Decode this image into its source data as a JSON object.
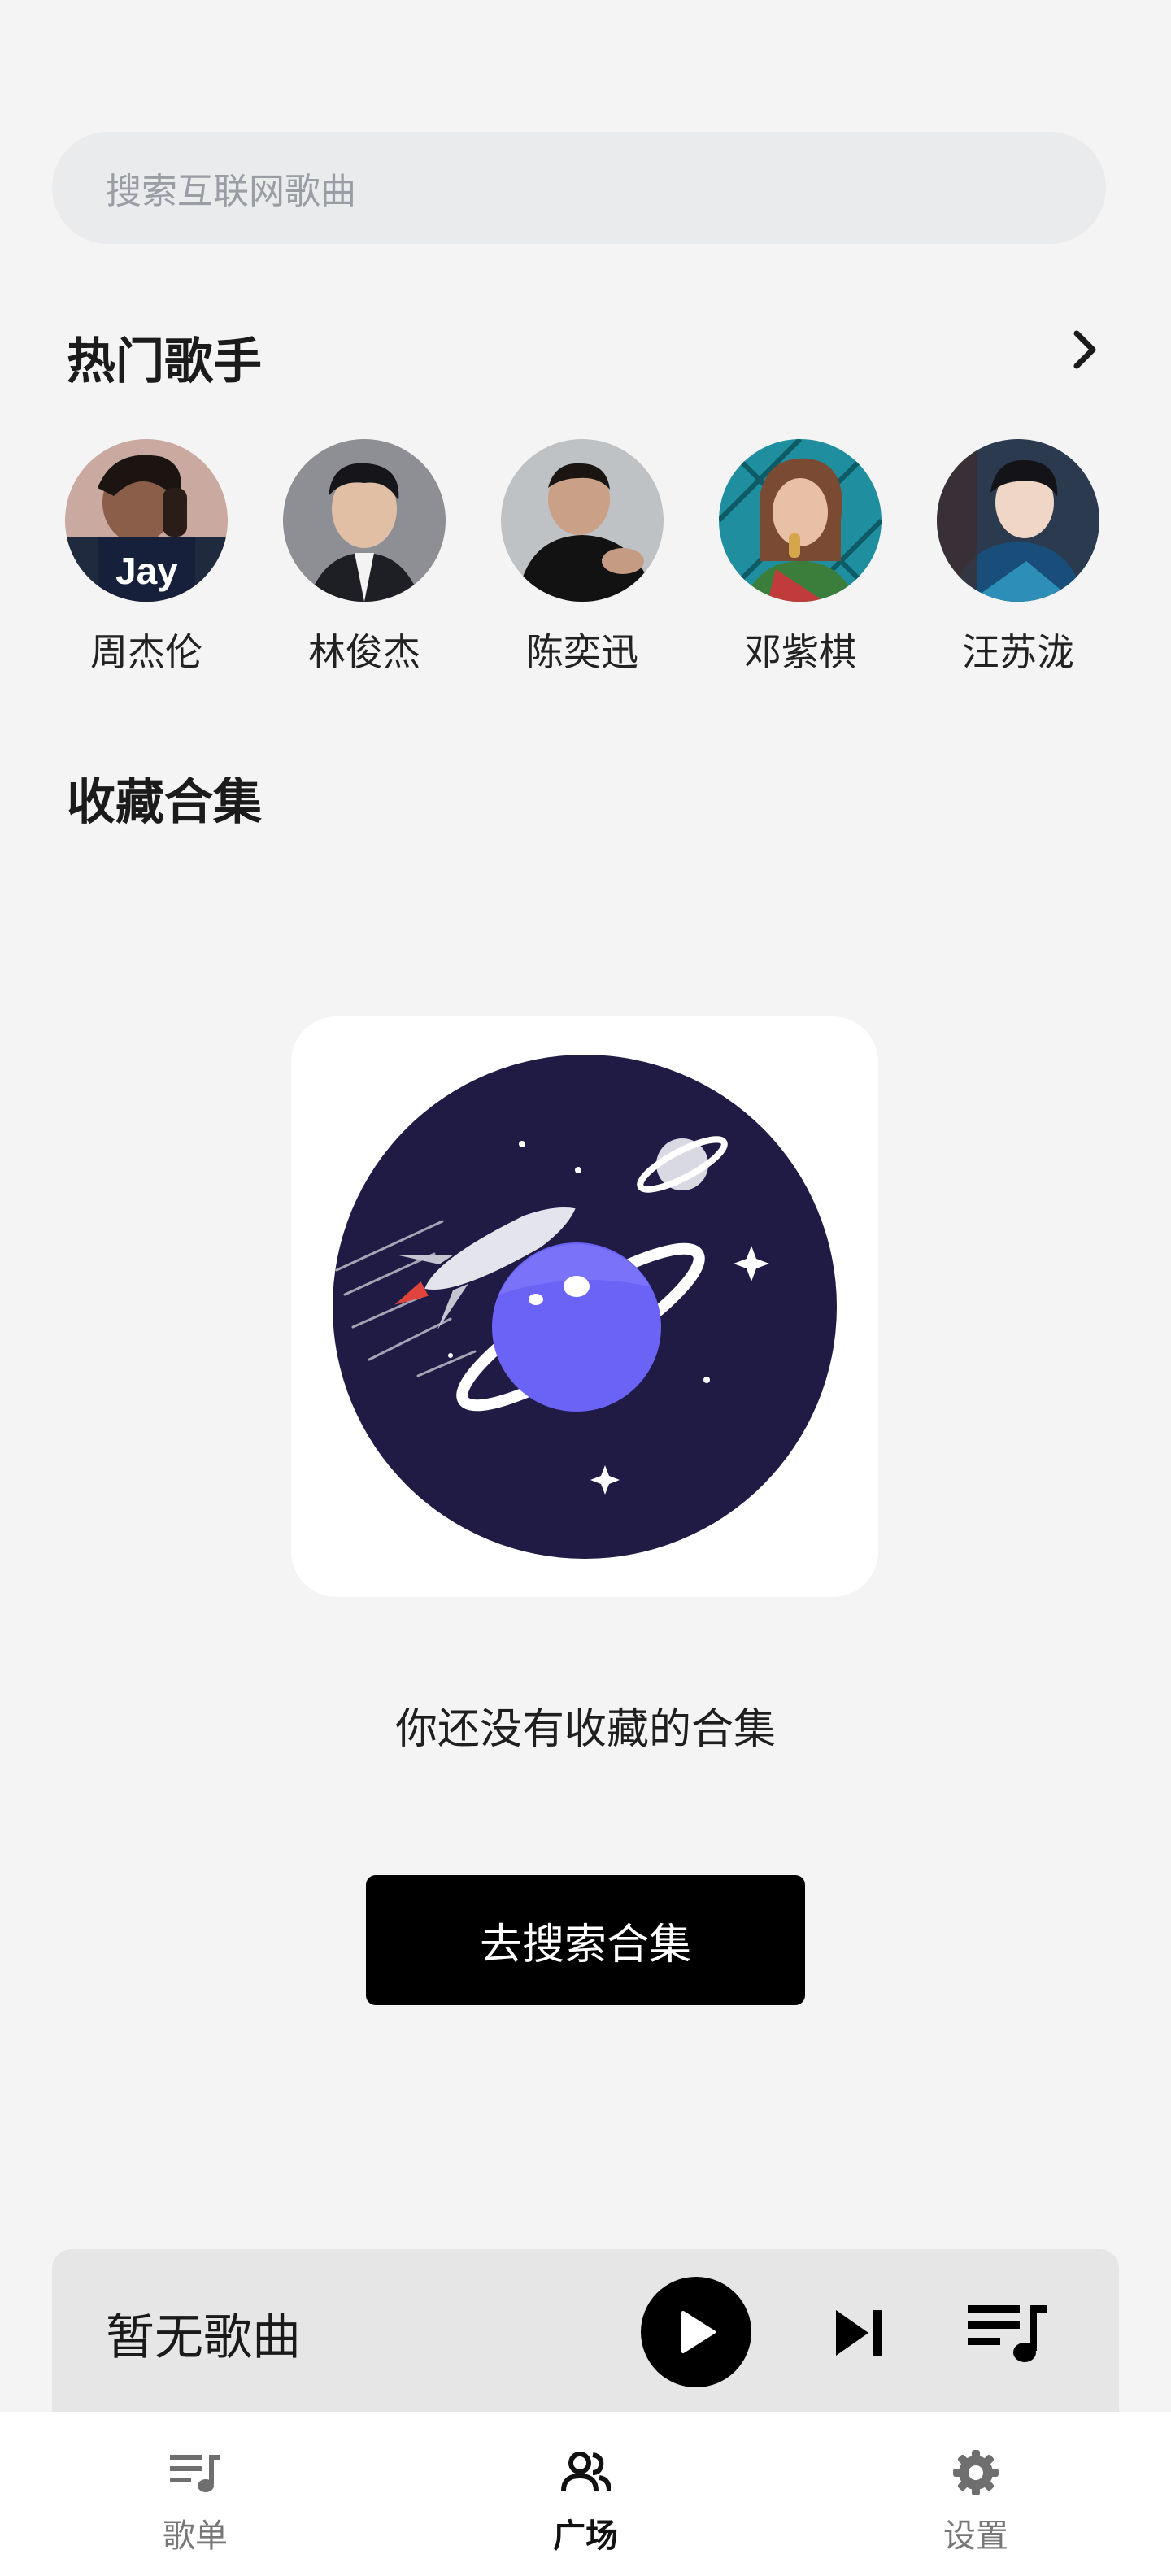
{
  "search": {
    "placeholder": "搜索互联网歌曲"
  },
  "hot_singers": {
    "title": "热门歌手",
    "more_icon": "chevron-right-icon",
    "items": [
      {
        "name": "周杰伦",
        "avatar_text": "Jay"
      },
      {
        "name": "林俊杰"
      },
      {
        "name": "陈奕迅"
      },
      {
        "name": "邓紫棋"
      },
      {
        "name": "汪苏泷"
      }
    ]
  },
  "favorites": {
    "title": "收藏合集",
    "empty_text": "你还没有收藏的合集",
    "button_label": "去搜索合集",
    "illustration": "planet-rocket-illustration"
  },
  "player": {
    "current_song": "暂无歌曲",
    "play_icon": "play-icon",
    "next_icon": "skip-next-icon",
    "queue_icon": "playlist-icon"
  },
  "bottom_nav": {
    "items": [
      {
        "label": "歌单",
        "icon": "playlist-icon",
        "active": false
      },
      {
        "label": "广场",
        "icon": "people-icon",
        "active": true
      },
      {
        "label": "设置",
        "icon": "gear-icon",
        "active": false
      }
    ]
  },
  "colors": {
    "background": "#f4f4f4",
    "illustration_space": "#1f1b45",
    "illustration_planet": "#6b63f5",
    "button": "#000000"
  }
}
